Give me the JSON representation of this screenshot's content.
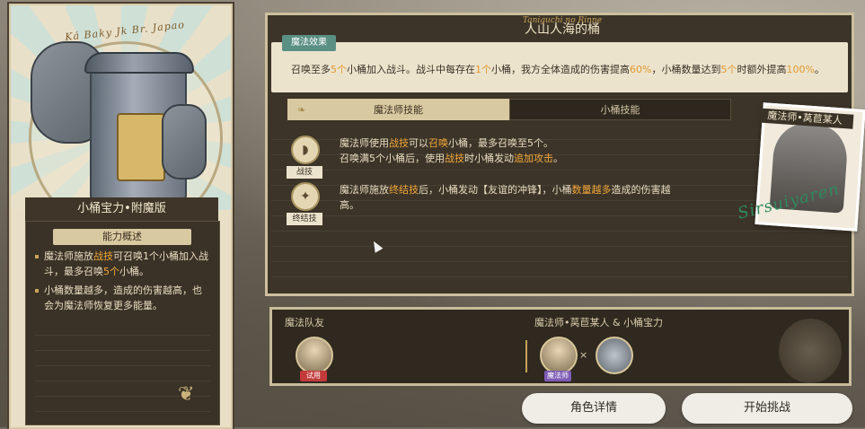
{
  "card": {
    "script_title": "Ká Baky Jk Br. Japao",
    "name": "小桶宝力•附魔版",
    "overview_heading": "能力概述",
    "overview_lines": [
      {
        "pre": "魔法师施放",
        "hl": "战技",
        "post": "可召唤1个小桶加入战斗，最多召唤",
        "hl2": "5个",
        "post2": "小桶。"
      },
      {
        "pre": "小桶数量越多，造成的伤害越高，也会为魔法师恢复更多能量。"
      }
    ]
  },
  "main": {
    "script_header": "Taniguchi no Rinne",
    "title": "人山人海的桶",
    "effect_tag": "魔法效果",
    "effect_parts": [
      "召唤至多",
      "5个",
      "小桶加入战斗。战斗中每存在",
      "1个",
      "小桶，我方全体造成的伤害提高",
      "60%",
      "，小桶数量达到",
      "5个",
      "时额外提高",
      "100%",
      "。"
    ],
    "tabs": [
      {
        "label": "魔法师技能",
        "active": true
      },
      {
        "label": "小桶技能",
        "active": false
      }
    ],
    "skills": [
      {
        "badge": "战技",
        "icon": "skill-battle-icon",
        "lines": [
          [
            "魔法师使用",
            "战技",
            "可以",
            "召唤",
            "小桶，最多召唤至5个。"
          ],
          [
            "召唤满5个小桶后，使用",
            "战技",
            "时小桶发动",
            "追加攻击",
            "。"
          ]
        ]
      },
      {
        "badge": "终结技",
        "icon": "skill-ultimate-icon",
        "lines": [
          [
            "魔法师施放",
            "终结技",
            "后，小桶发动【友谊的冲锋】，小桶",
            "数量越多",
            "造成的伤害越"
          ],
          [
            "高。"
          ]
        ]
      }
    ]
  },
  "portrait": {
    "label": "魔法师•莴苣某人",
    "signature": "Sirsuiyaren"
  },
  "team": {
    "left_label": "魔法队友",
    "right_label": "魔法师•莴苣某人 & 小桶宝力",
    "left_member_tag": "试用",
    "right_member_tag": "魔法师",
    "times": "×"
  },
  "buttons": {
    "details": "角色详情",
    "start": "开始挑战"
  },
  "colors": {
    "accent_orange": "#f3a73a",
    "teal_tag": "#5a8f84",
    "trial_red": "#c23a3a",
    "mage_purple": "#7d5bb5"
  }
}
